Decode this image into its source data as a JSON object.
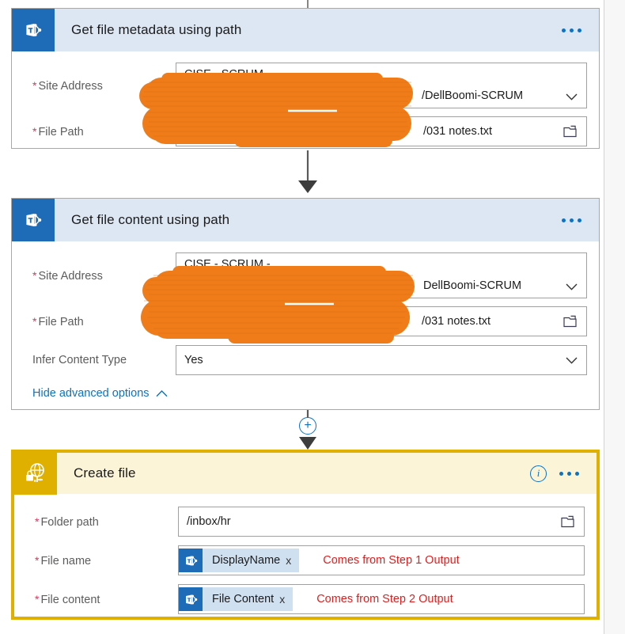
{
  "colors": {
    "sharepoint_blue": "#1e6bb8",
    "header_blue": "#dce7f3",
    "ftp_yellow": "#e0b000",
    "header_yellow": "#fcf4d6",
    "link_blue": "#0b72c4",
    "required_red": "#d6355c",
    "annotation_red": "#e02020",
    "redaction_orange": "#ef7c18"
  },
  "cards": [
    {
      "id": "get-file-metadata-using-path",
      "title": "Get file metadata using path",
      "icon": "sharepoint-icon",
      "menu_icon": "ellipsis-icon",
      "fields": [
        {
          "label": "Site Address",
          "required": true,
          "value": "CISE - SCRUM -",
          "value_tail": "/DellBoomi-SCRUM",
          "control": "dropdown",
          "control_icon": "chevron-down-icon",
          "redacted": true
        },
        {
          "label": "File Path",
          "required": true,
          "value_tail": "/031 notes.txt",
          "control": "textbox",
          "control_icon": "folder-picker-icon",
          "redacted": true
        }
      ]
    },
    {
      "id": "get-file-content-using-path",
      "title": "Get file content using path",
      "icon": "sharepoint-icon",
      "menu_icon": "ellipsis-icon",
      "fields": [
        {
          "label": "Site Address",
          "required": true,
          "value": "CISE - SCRUM -",
          "value_tail": "DellBoomi-SCRUM",
          "control": "dropdown",
          "control_icon": "chevron-down-icon",
          "redacted": true
        },
        {
          "label": "File Path",
          "required": true,
          "value_tail": "/031 notes.txt",
          "control": "textbox",
          "control_icon": "folder-picker-icon",
          "redacted": true
        },
        {
          "label": "Infer Content Type",
          "required": false,
          "value": "Yes",
          "control": "dropdown",
          "control_icon": "chevron-down-icon",
          "redacted": false
        }
      ],
      "advanced_link": {
        "label": "Hide advanced options",
        "icon": "chevron-up-icon"
      }
    },
    {
      "id": "create-file",
      "title": "Create file",
      "icon": "ftp-globe-lock-icon",
      "info_icon": "info-circle-icon",
      "menu_icon": "ellipsis-icon",
      "selected": true,
      "fields": [
        {
          "label": "Folder path",
          "required": true,
          "value": "/inbox/hr",
          "control": "textbox",
          "control_icon": "folder-picker-icon"
        },
        {
          "label": "File name",
          "required": true,
          "control": "token",
          "token": {
            "icon": "sharepoint-icon",
            "label": "DisplayName",
            "remove_icon": "x-icon",
            "remove_label": "x"
          },
          "annotation": "Comes from Step 1 Output"
        },
        {
          "label": "File content",
          "required": true,
          "control": "token",
          "token": {
            "icon": "sharepoint-icon",
            "label": "File Content",
            "remove_icon": "x-icon",
            "remove_label": "x"
          },
          "annotation": "Comes from Step 2 Output"
        }
      ]
    }
  ],
  "connectors": [
    {
      "id": "connector-top",
      "type": "line"
    },
    {
      "id": "connector-1-to-2",
      "type": "arrow"
    },
    {
      "id": "connector-2-to-3",
      "type": "arrow-with-add",
      "add_label": "+"
    }
  ]
}
